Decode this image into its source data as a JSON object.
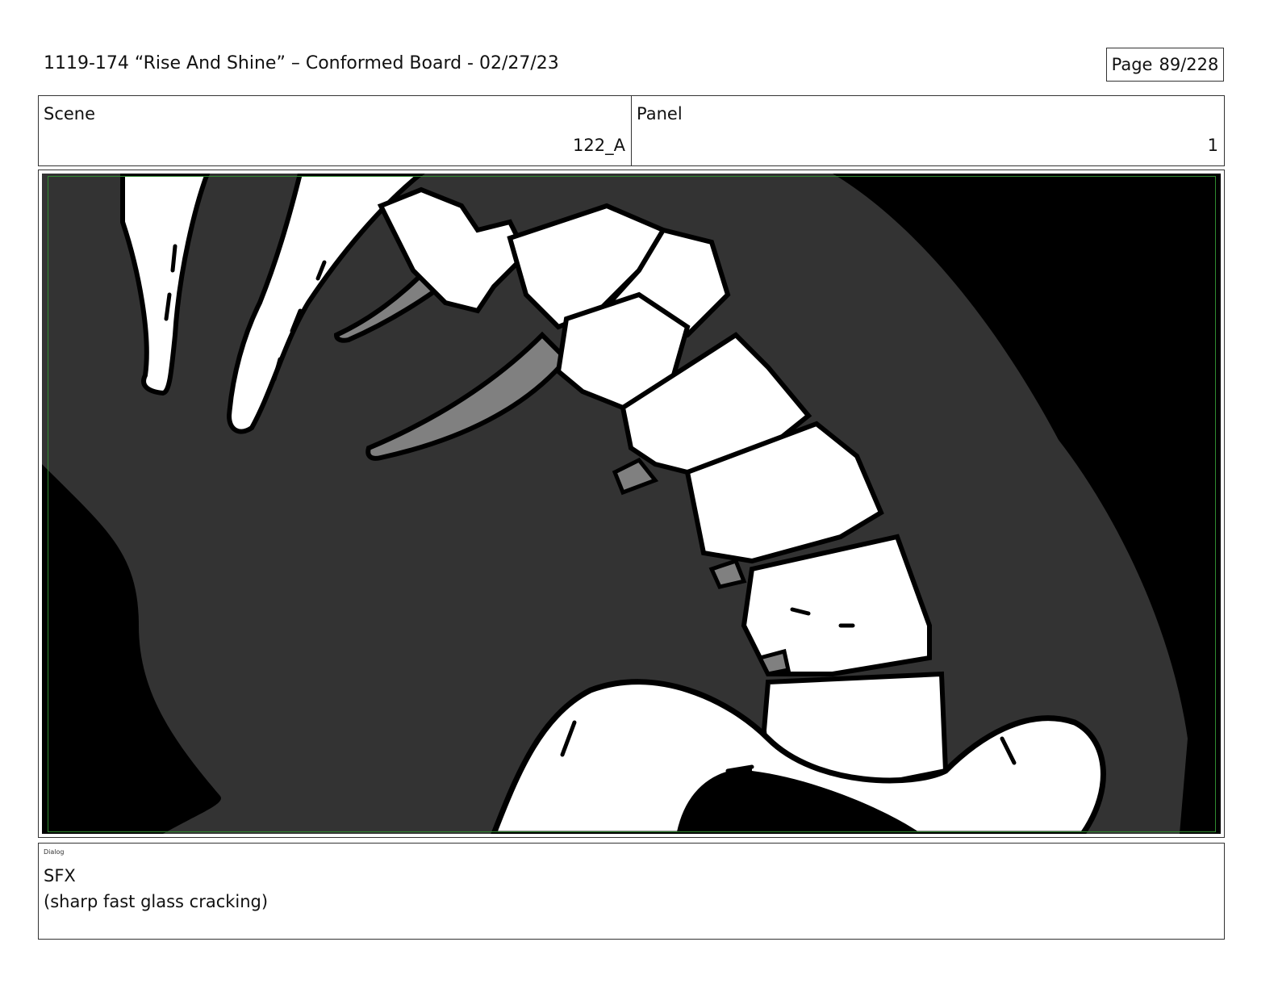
{
  "header": {
    "title": "1119-174 “Rise And Shine” – Conformed Board - 02/27/23",
    "page_label": "Page",
    "page_number": "89/228"
  },
  "info": {
    "scene_label": "Scene",
    "scene_value": "122_A",
    "panel_label": "Panel",
    "panel_value": "1"
  },
  "panel": {
    "colors": {
      "background": "#000000",
      "shadow": "#333333",
      "mid": "#808080",
      "highlight": "#ffffff",
      "safe_frame": "#2f8a2f"
    }
  },
  "dialog": {
    "tag": "Dialog",
    "line1": "SFX",
    "line2": "(sharp fast glass cracking)"
  }
}
